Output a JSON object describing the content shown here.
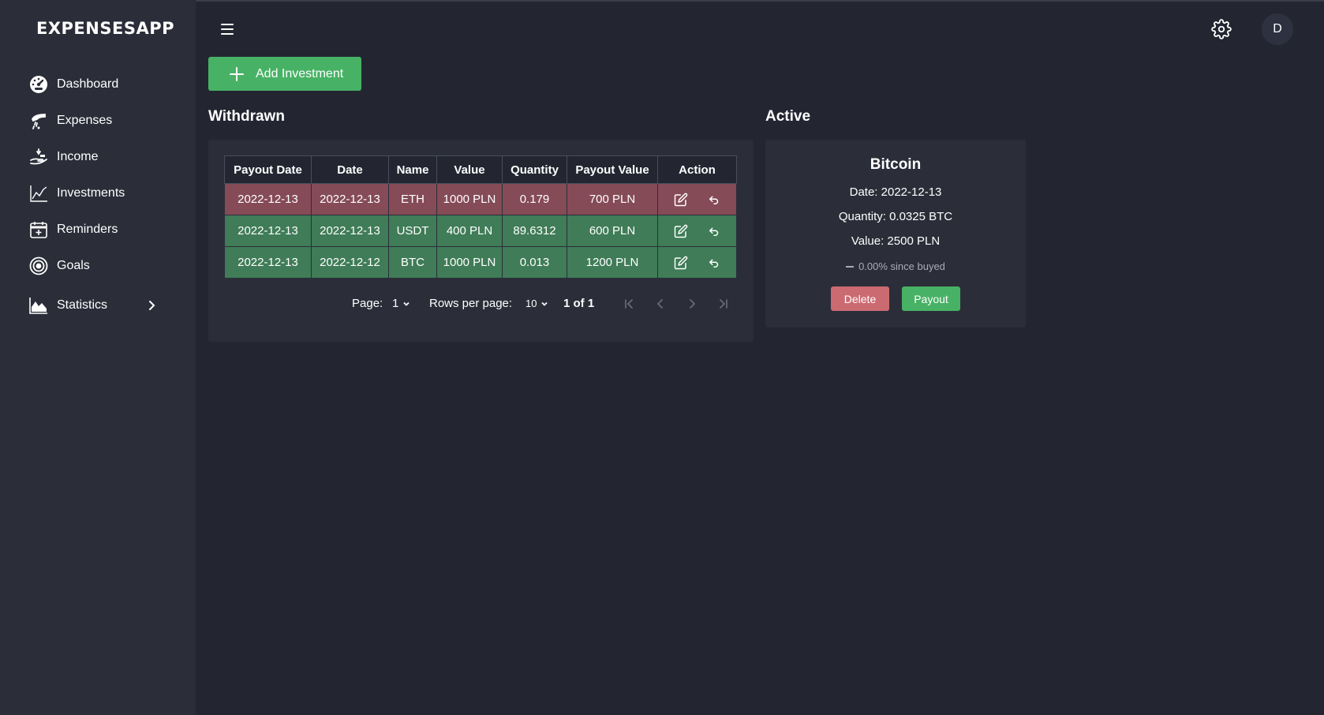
{
  "app": {
    "logo": "EXPENSESAPP"
  },
  "sidebar": {
    "items": [
      {
        "label": "Dashboard",
        "icon": "dashboard-gauge-icon"
      },
      {
        "label": "Expenses",
        "icon": "expenses-hand-icon"
      },
      {
        "label": "Income",
        "icon": "income-hand-icon"
      },
      {
        "label": "Investments",
        "icon": "line-chart-icon"
      },
      {
        "label": "Reminders",
        "icon": "calendar-plus-icon"
      },
      {
        "label": "Goals",
        "icon": "target-icon"
      },
      {
        "label": "Statistics",
        "icon": "area-chart-icon"
      }
    ]
  },
  "header": {
    "avatar_initial": "D"
  },
  "toolbar": {
    "add_label": "Add Investment"
  },
  "withdrawn": {
    "title": "Withdrawn",
    "columns": [
      "Payout Date",
      "Date",
      "Name",
      "Value",
      "Quantity",
      "Payout Value",
      "Action"
    ],
    "rows": [
      {
        "payout_date": "2022-12-13",
        "date": "2022-12-13",
        "name": "ETH",
        "value": "1000 PLN",
        "quantity": "0.179",
        "payout_value": "700 PLN",
        "status": "loss"
      },
      {
        "payout_date": "2022-12-13",
        "date": "2022-12-13",
        "name": "USDT",
        "value": "400 PLN",
        "quantity": "89.6312",
        "payout_value": "600 PLN",
        "status": "gain"
      },
      {
        "payout_date": "2022-12-13",
        "date": "2022-12-12",
        "name": "BTC",
        "value": "1000 PLN",
        "quantity": "0.013",
        "payout_value": "1200 PLN",
        "status": "gain"
      }
    ],
    "pagination": {
      "page_label": "Page:",
      "page_value": "1",
      "rows_label": "Rows per page:",
      "rows_value": "10",
      "range": "1 of 1"
    }
  },
  "active": {
    "title": "Active",
    "card": {
      "name": "Bitcoin",
      "date": "Date: 2022-12-13",
      "quantity": "Quantity: 0.0325 BTC",
      "value": "Value: 2500 PLN",
      "change": "0.00% since buyed",
      "delete_label": "Delete",
      "payout_label": "Payout"
    }
  },
  "colors": {
    "accent_green": "#47b265",
    "row_loss": "#854b57",
    "row_gain": "#3f7c57",
    "delete_red": "#cc6a72",
    "background": "#232631",
    "panel": "#2b2e39"
  }
}
